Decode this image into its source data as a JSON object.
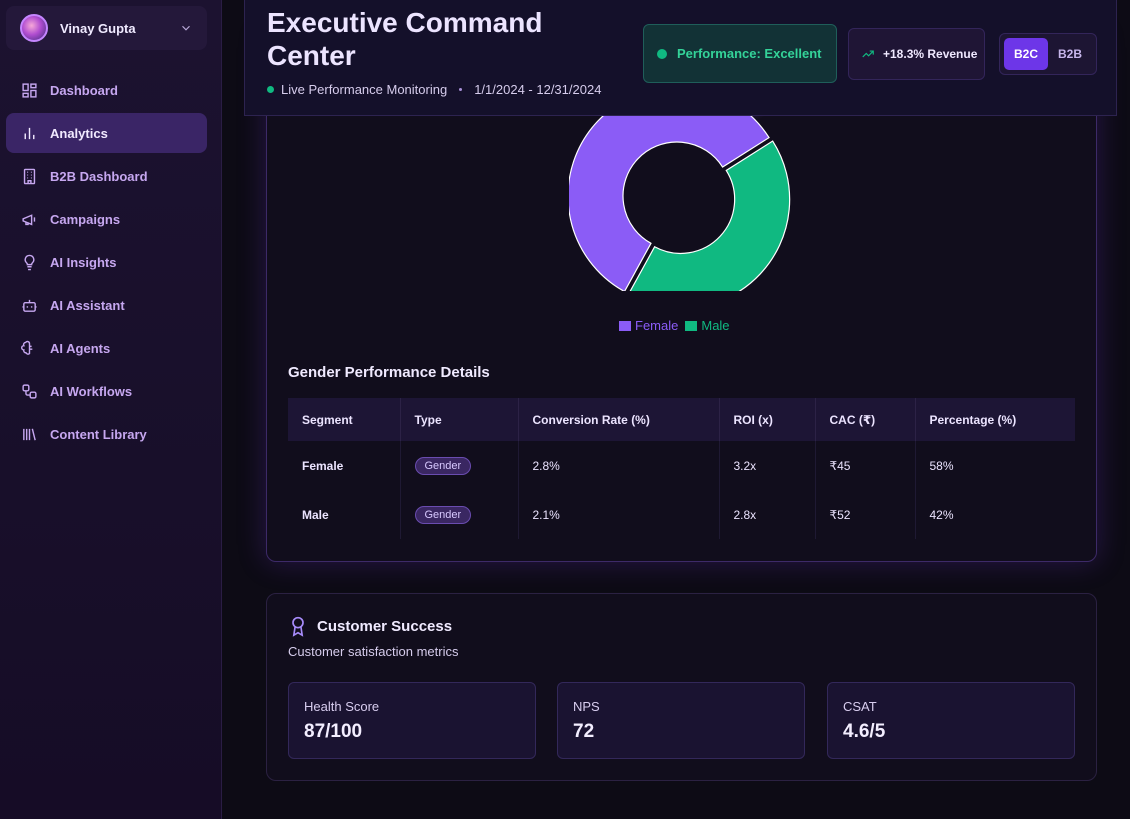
{
  "user": {
    "name": "Vinay Gupta"
  },
  "sidebar": {
    "items": [
      {
        "label": "Dashboard",
        "icon": "dashboard-icon"
      },
      {
        "label": "Analytics",
        "icon": "bar-chart-icon",
        "active": true
      },
      {
        "label": "B2B Dashboard",
        "icon": "building-icon"
      },
      {
        "label": "Campaigns",
        "icon": "megaphone-icon"
      },
      {
        "label": "AI Insights",
        "icon": "lightbulb-icon"
      },
      {
        "label": "AI Assistant",
        "icon": "bot-icon"
      },
      {
        "label": "AI Agents",
        "icon": "brain-icon"
      },
      {
        "label": "AI Workflows",
        "icon": "workflow-icon"
      },
      {
        "label": "Content Library",
        "icon": "library-icon"
      }
    ]
  },
  "header": {
    "title": "Executive Command Center",
    "live_label": "Live Performance Monitoring",
    "date_range": "1/1/2024 - 12/31/2024",
    "performance": "Performance: Excellent",
    "revenue_change": "+18.3% Revenue",
    "segments": [
      "B2C",
      "B2B"
    ],
    "active_segment": "B2C"
  },
  "colors": {
    "female": "#8b5cf6",
    "male": "#10b981",
    "accent": "#6d36e8"
  },
  "chart_data": {
    "type": "pie",
    "categories": [
      "Female",
      "Male"
    ],
    "values": [
      58,
      42
    ],
    "legend": "bottom-center"
  },
  "gender_details": {
    "title": "Gender Performance Details",
    "columns": [
      "Segment",
      "Type",
      "Conversion Rate (%)",
      "ROI (x)",
      "CAC (₹)",
      "Percentage (%)"
    ],
    "rows": [
      {
        "segment": "Female",
        "type": "Gender",
        "conversion": "2.8%",
        "roi": "3.2x",
        "cac": "₹45",
        "percentage": "58%"
      },
      {
        "segment": "Male",
        "type": "Gender",
        "conversion": "2.1%",
        "roi": "2.8x",
        "cac": "₹52",
        "percentage": "42%"
      }
    ]
  },
  "customer_success": {
    "title": "Customer Success",
    "subtitle": "Customer satisfaction metrics",
    "metrics": [
      {
        "label": "Health Score",
        "value": "87/100"
      },
      {
        "label": "NPS",
        "value": "72"
      },
      {
        "label": "CSAT",
        "value": "4.6/5"
      }
    ]
  }
}
